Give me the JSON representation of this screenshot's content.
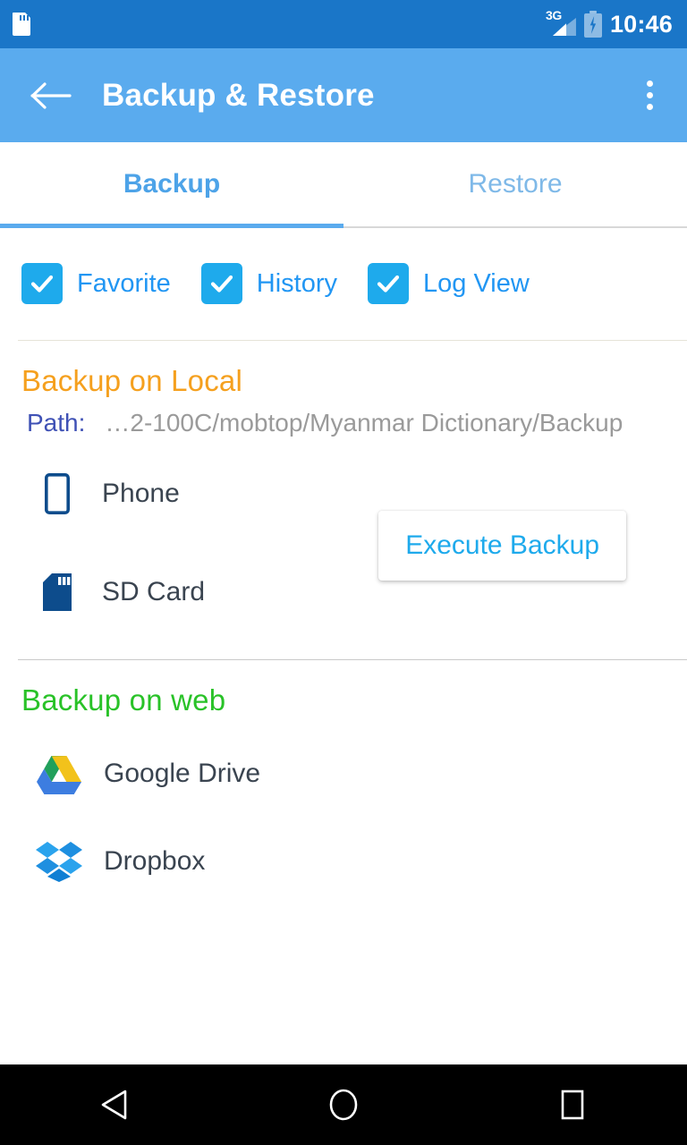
{
  "status_bar": {
    "notification_icon": "sd-card-icon",
    "network_label": "3G",
    "signal_icon": "signal-triangle-icon",
    "battery_icon": "battery-charging-icon",
    "time": "10:46",
    "background_color": "#1a76c8"
  },
  "app_bar": {
    "back_icon": "back-arrow-icon",
    "title": "Backup & Restore",
    "overflow_icon": "overflow-menu-icon",
    "background_color": "#5aabee"
  },
  "tabs": {
    "items": [
      {
        "label": "Backup",
        "active": true
      },
      {
        "label": "Restore",
        "active": false
      }
    ],
    "active_color": "#4da3e8",
    "inactive_color": "#7fb9e8",
    "indicator_color": "#5aabee"
  },
  "options": {
    "items": [
      {
        "label": "Favorite",
        "checked": true
      },
      {
        "label": "History",
        "checked": true
      },
      {
        "label": "Log View",
        "checked": true
      }
    ],
    "checkbox_color": "#1eaaec",
    "label_color": "#2196f3"
  },
  "local_section": {
    "title": "Backup on Local",
    "title_color": "#f5a01e",
    "path_label": "Path:",
    "path_value": "…2-100C/mobtop/Myanmar Dictionary/Backup",
    "path_label_color": "#3f51b5",
    "path_value_color": "#9a9a9a",
    "targets": [
      {
        "label": "Phone",
        "icon": "phone-icon"
      },
      {
        "label": "SD Card",
        "icon": "sd-card-icon"
      }
    ],
    "icon_color": "#0d4c8c",
    "execute_button": {
      "label": "Execute Backup",
      "text_color": "#1eaaec"
    }
  },
  "web_section": {
    "title": "Backup on web",
    "title_color": "#29c228",
    "services": [
      {
        "label": "Google Drive",
        "icon": "google-drive-icon"
      },
      {
        "label": "Dropbox",
        "icon": "dropbox-icon"
      }
    ]
  },
  "nav_bar": {
    "back_icon": "nav-back-triangle-icon",
    "home_icon": "nav-home-circle-icon",
    "recents_icon": "nav-recents-square-icon",
    "background_color": "#000000"
  }
}
